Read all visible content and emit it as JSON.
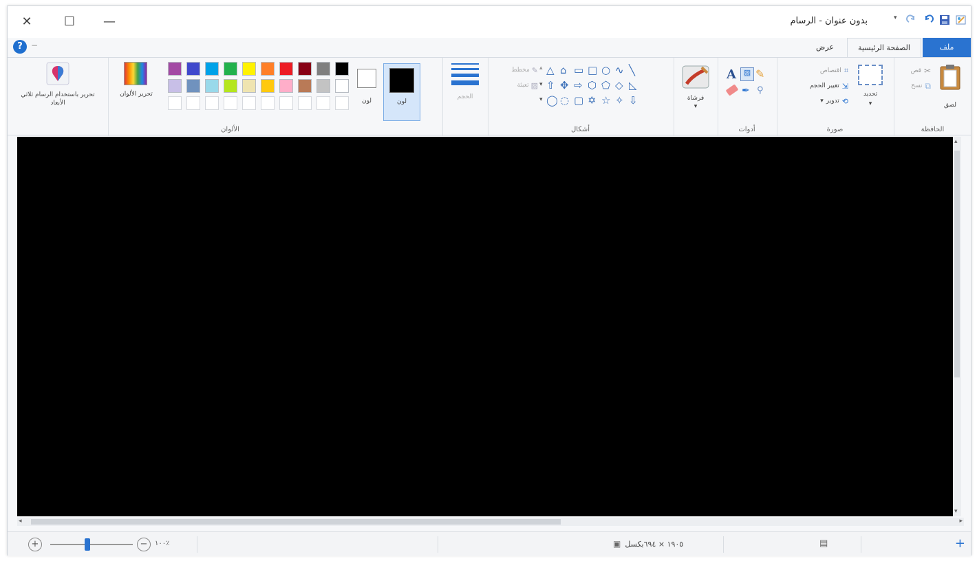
{
  "window": {
    "title": "بدون عنوان - الرسام",
    "controls": {
      "close": "✕",
      "maximize": "☐",
      "minimize": "—"
    }
  },
  "tabs": [
    {
      "label": "ملف",
      "active": false,
      "accent": "#2a73d0"
    },
    {
      "label": "الصفحة الرئيسية",
      "active": true
    },
    {
      "label": "عرض",
      "active": false
    }
  ],
  "help": {
    "label": "?",
    "dash": "−"
  },
  "ribbon": {
    "clipboard": {
      "group_label": "الحافظة",
      "paste_label": "لصق",
      "cut_label": "قص",
      "copy_label": "نسخ"
    },
    "image": {
      "group_label": "صورة",
      "select_label": "تحديد",
      "crop_label": "اقتصاص",
      "resize_label": "تغيير الحجم",
      "rotate_label": "تدوير"
    },
    "tools": {
      "group_label": "أدوات",
      "text_glyph": "A"
    },
    "brushes": {
      "label": "فرشاة"
    },
    "shapes": {
      "group_label": "أشكال",
      "outline_label": "مخطط",
      "fill_label": "تعبئة"
    },
    "size": {
      "label": "الحجم"
    },
    "color1": {
      "label": "لون",
      "value": "#000000"
    },
    "color2": {
      "label": "لون",
      "value": "#ffffff"
    },
    "colors": {
      "group_label": "الألوان",
      "edit_label": "تحرير الألوان",
      "edit3d_label": "تحرير باستخدام الرسام ثلاثي الأبعاد",
      "row1": [
        "#000000",
        "#7f7f7f",
        "#880015",
        "#ed1c24",
        "#ff7f27",
        "#fff200",
        "#22b14c",
        "#00a2e8",
        "#3f48cc",
        "#a349a4"
      ],
      "row2": [
        "#ffffff",
        "#c3c3c3",
        "#b97a57",
        "#ffaec9",
        "#ffc90e",
        "#efe4b0",
        "#b5e61d",
        "#99d9ea",
        "#7092be",
        "#c8bfe7"
      ]
    }
  },
  "status": {
    "canvas_size": "١٩٠٥ × ٦٩٤بكسل",
    "zoom": "١٠٠٪"
  }
}
